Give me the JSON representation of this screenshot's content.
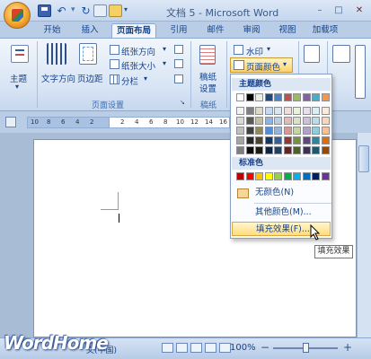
{
  "window": {
    "title": "文档 5 - Microsoft Word",
    "min": "–",
    "max": "□",
    "close": "✕"
  },
  "qat": {
    "undo": "↶",
    "redo": "↻",
    "more": "▾"
  },
  "tabs": [
    "开始",
    "插入",
    "页面布局",
    "引用",
    "邮件",
    "审阅",
    "视图",
    "加载项"
  ],
  "active_tab": "页面布局",
  "ribbon": {
    "theme_label": "主题",
    "text_direction": "文字方向",
    "margins": "页边距",
    "orientation": "纸张方向",
    "size": "纸张大小",
    "columns": "分栏",
    "page_setup_group": "页面设置",
    "draft_paper": "稿纸",
    "draft_setting": "设置",
    "draft_group": "稿纸",
    "watermark": "水印",
    "page_color": "页面颜色",
    "orientation_arrow": "▾",
    "size_arrow": "▾",
    "columns_arrow": "▾",
    "watermark_arrow": "▾",
    "page_color_arrow": "▾"
  },
  "ruler": {
    "numbers": [
      "10",
      "8",
      "6",
      "4",
      "2",
      "2",
      "4",
      "6",
      "8",
      "10",
      "12",
      "14",
      "16"
    ]
  },
  "dropdown": {
    "theme_colors_header": "主题颜色",
    "standard_colors_header": "标准色",
    "no_color": "无颜色(N)",
    "more_colors": "其他颜色(M)...",
    "fill_effects": "填充效果(F)..."
  },
  "tooltip": "填充效果",
  "status": {
    "language": "文(中国)",
    "zoom": "100%",
    "zoom_minus": "−",
    "zoom_plus": "+"
  },
  "watermark_text": "WordHome",
  "colors": {
    "theme_rows": [
      [
        "#ffffff",
        "#000000",
        "#eeece1",
        "#1f497d",
        "#4f81bd",
        "#c0504d",
        "#9bbb59",
        "#8064a2",
        "#4bacc6",
        "#f79646"
      ],
      [
        "#f2f2f2",
        "#7f7f7f",
        "#ddd9c3",
        "#c6d9f0",
        "#dbe5f1",
        "#f2dcdb",
        "#ebf1dd",
        "#e5e0ec",
        "#dbeef3",
        "#fdeada"
      ],
      [
        "#d8d8d8",
        "#595959",
        "#c4bd97",
        "#8db3e2",
        "#b8cce4",
        "#e5b9b7",
        "#d7e3bc",
        "#ccc1d9",
        "#b7dde8",
        "#fbd5b5"
      ],
      [
        "#bfbfbf",
        "#3f3f3f",
        "#938953",
        "#548dd4",
        "#95b3d7",
        "#d99694",
        "#c3d69b",
        "#b2a2c7",
        "#92cddc",
        "#fac08f"
      ],
      [
        "#a5a5a5",
        "#262626",
        "#494429",
        "#17365d",
        "#366092",
        "#953734",
        "#76923c",
        "#5f497a",
        "#31859b",
        "#e36c09"
      ],
      [
        "#7f7f7f",
        "#0c0c0c",
        "#1d1b10",
        "#0f243e",
        "#244061",
        "#632423",
        "#4f6128",
        "#3f3151",
        "#205867",
        "#974806"
      ]
    ],
    "standard": [
      "#c00000",
      "#ff0000",
      "#ffc000",
      "#ffff00",
      "#92d050",
      "#00b050",
      "#00b0f0",
      "#0070c0",
      "#002060",
      "#7030a0"
    ]
  }
}
